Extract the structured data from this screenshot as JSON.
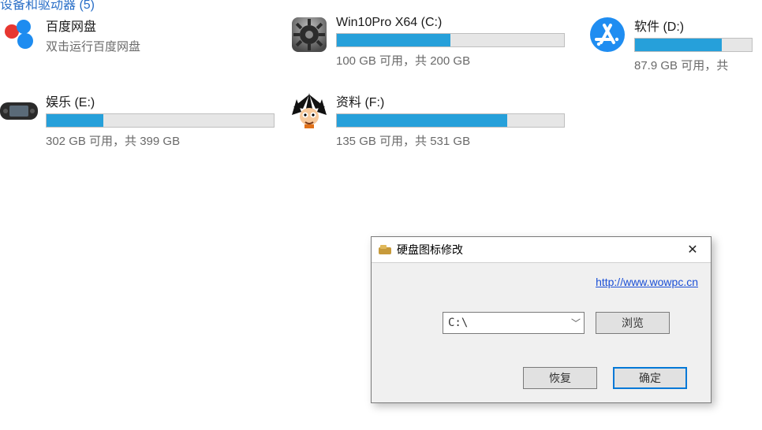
{
  "header_fragment": "设备和驱动器 (5)",
  "items": {
    "baidu": {
      "title": "百度网盘",
      "sub": "双击运行百度网盘"
    },
    "c": {
      "title": "Win10Pro X64 (C:)",
      "sub": "100 GB 可用，共 200 GB",
      "fill_pct": 50
    },
    "d": {
      "title": "软件 (D:)",
      "sub": "87.9 GB 可用，共",
      "fill_pct": 74
    },
    "e": {
      "title": "娱乐 (E:)",
      "sub": "302 GB 可用，共 399 GB",
      "fill_pct": 25
    },
    "f": {
      "title": "资料 (F:)",
      "sub": "135 GB 可用，共 531 GB",
      "fill_pct": 75
    }
  },
  "dialog": {
    "title": "硬盘图标修改",
    "link": "http://www.wowpc.cn",
    "combo_value": "C:\\",
    "browse": "浏览",
    "restore": "恢复",
    "ok": "确定"
  }
}
